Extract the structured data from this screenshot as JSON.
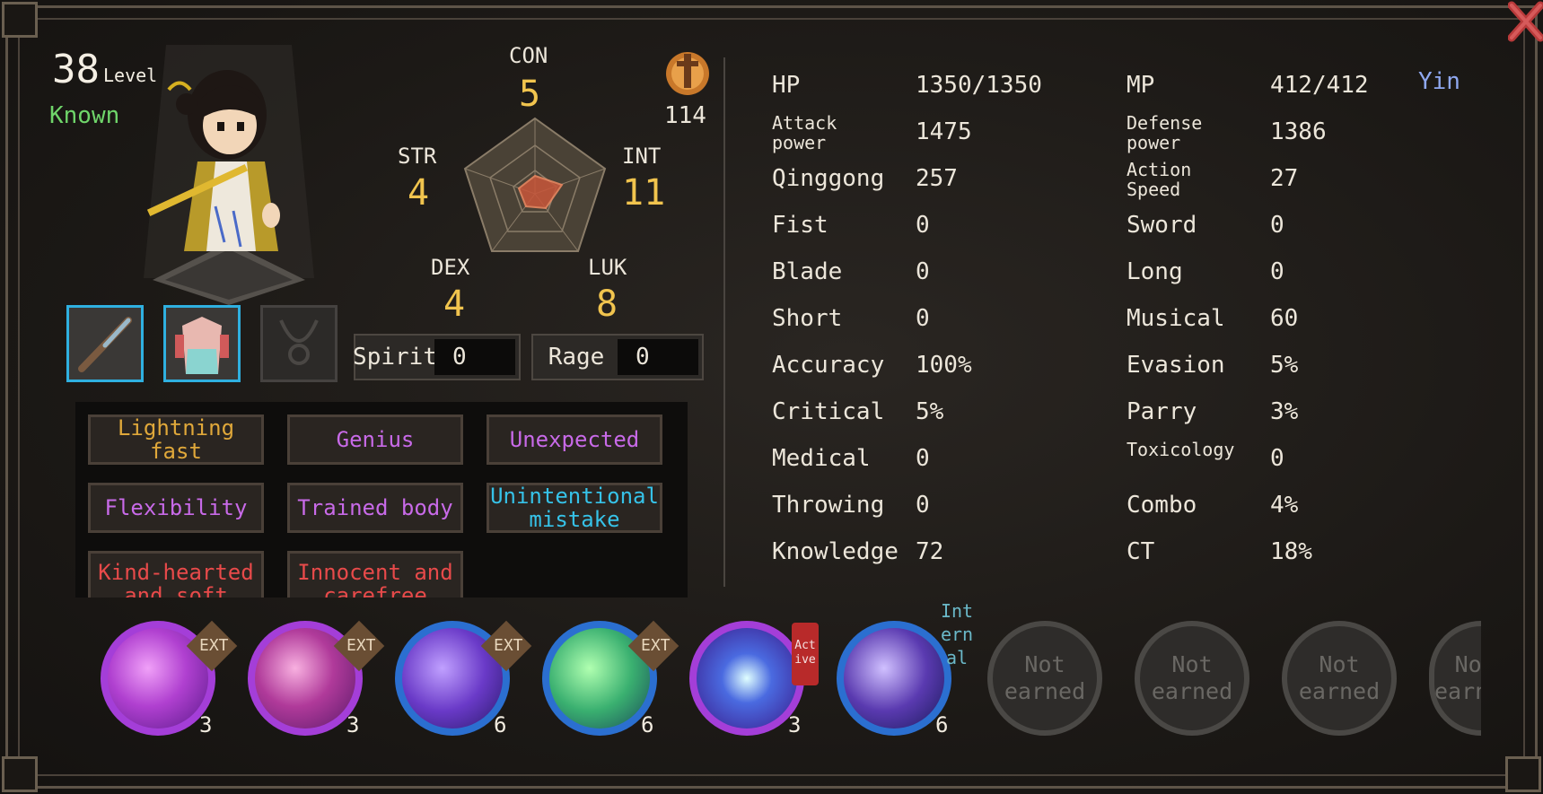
{
  "character": {
    "level": "38",
    "level_label": "Level",
    "status": "Known",
    "affinity": "Yin",
    "reputation": "114"
  },
  "attributes": {
    "con": {
      "label": "CON",
      "value": "5"
    },
    "str": {
      "label": "STR",
      "value": "4"
    },
    "int": {
      "label": "INT",
      "value": "11"
    },
    "dex": {
      "label": "DEX",
      "value": "4"
    },
    "luk": {
      "label": "LUK",
      "value": "8"
    }
  },
  "bars": {
    "spirit": {
      "label": "Spirit",
      "value": "0"
    },
    "rage": {
      "label": "Rage",
      "value": "0"
    }
  },
  "stats_left": [
    {
      "label": "HP",
      "value": "1350/1350"
    },
    {
      "label": "Attack power",
      "value": "1475"
    },
    {
      "label": "Qinggong",
      "value": "257"
    },
    {
      "label": "Fist",
      "value": "0"
    },
    {
      "label": "Blade",
      "value": "0"
    },
    {
      "label": "Short",
      "value": "0"
    },
    {
      "label": "Accuracy",
      "value": "100%"
    },
    {
      "label": "Critical",
      "value": "5%"
    },
    {
      "label": "Medical",
      "value": "0"
    },
    {
      "label": "Throwing",
      "value": "0"
    },
    {
      "label": "Knowledge",
      "value": "72"
    }
  ],
  "stats_right": [
    {
      "label": "MP",
      "value": "412/412"
    },
    {
      "label": "Defense power",
      "value": "1386"
    },
    {
      "label": "Action Speed",
      "value": "27"
    },
    {
      "label": "Sword",
      "value": "0"
    },
    {
      "label": "Long",
      "value": "0"
    },
    {
      "label": "Musical",
      "value": "60"
    },
    {
      "label": "Evasion",
      "value": "5%"
    },
    {
      "label": "Parry",
      "value": "3%"
    },
    {
      "label": "Toxicology",
      "value": "0"
    },
    {
      "label": "Combo",
      "value": "4%"
    },
    {
      "label": "CT",
      "value": "18%"
    }
  ],
  "traits": [
    {
      "label": "Lightning fast",
      "color": "#e0a83a"
    },
    {
      "label": "Genius",
      "color": "#c86ae8"
    },
    {
      "label": "Unexpected",
      "color": "#c86ae8"
    },
    {
      "label": "Flexibility",
      "color": "#c86ae8"
    },
    {
      "label": "Trained body",
      "color": "#c86ae8"
    },
    {
      "label": "Unintentional mistake",
      "color": "#36c2e8"
    },
    {
      "label": "Kind-hearted and soft",
      "color": "#e84a4a"
    },
    {
      "label": "Innocent and carefree",
      "color": "#e84a4a"
    }
  ],
  "skills": [
    {
      "badge": "EXT",
      "count": "3",
      "ring": "#a43ed8"
    },
    {
      "badge": "EXT",
      "count": "3",
      "ring": "#a43ed8"
    },
    {
      "badge": "EXT",
      "count": "6",
      "ring": "#2b6fd0"
    },
    {
      "badge": "EXT",
      "count": "6",
      "ring": "#2b6fd0"
    },
    {
      "badge": "Active",
      "count": "3",
      "ring": "#a43ed8"
    },
    {
      "badge": "Internal",
      "count": "6",
      "ring": "#2b6fd0"
    }
  ],
  "locked_skill_label": "Not earned",
  "colors": {
    "accent_yellow": "#f1c44e",
    "known_green": "#6fd56a",
    "yin_blue": "#8fa8f0",
    "equip_border": "#2fb0e0"
  }
}
